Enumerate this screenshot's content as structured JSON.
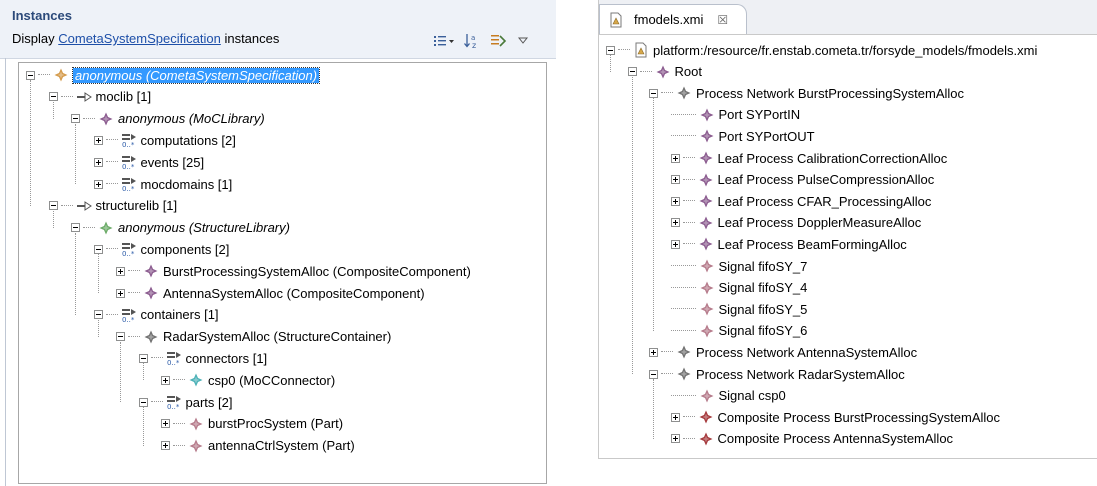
{
  "left_panel": {
    "title": "Instances",
    "display_prefix": "Display",
    "display_link": "CometaSystemSpecification",
    "display_suffix": "instances"
  },
  "left_tree": [
    {
      "label": "anonymous (CometaSystemSpecification)",
      "icon": "diamond-orange-icon",
      "style": "selected"
    },
    {
      "label": "moclib [1]",
      "icon": "arrow-link-icon"
    },
    {
      "label": "anonymous (MoCLibrary)",
      "icon": "diamond-purple-icon",
      "style": "italic"
    },
    {
      "label": "computations [2]",
      "icon": "collection-icon"
    },
    {
      "label": "events [25]",
      "icon": "collection-icon"
    },
    {
      "label": "mocdomains [1]",
      "icon": "collection-icon"
    },
    {
      "label": "structurelib [1]",
      "icon": "arrow-link-icon"
    },
    {
      "label": "anonymous (StructureLibrary)",
      "icon": "diamond-green-icon",
      "style": "italic"
    },
    {
      "label": "components [2]",
      "icon": "collection-icon"
    },
    {
      "label": "BurstProcessingSystemAlloc (CompositeComponent)",
      "icon": "diamond-purple-icon"
    },
    {
      "label": "AntennaSystemAlloc (CompositeComponent)",
      "icon": "diamond-purple-icon"
    },
    {
      "label": "containers [1]",
      "icon": "collection-icon"
    },
    {
      "label": "RadarSystemAlloc (StructureContainer)",
      "icon": "diamond-gray-icon"
    },
    {
      "label": "connectors [1]",
      "icon": "collection-icon"
    },
    {
      "label": "csp0 (MoCConnector)",
      "icon": "diamond-teal-icon"
    },
    {
      "label": "parts [2]",
      "icon": "collection-icon"
    },
    {
      "label": "burstProcSystem (Part)",
      "icon": "diamond-pink-icon"
    },
    {
      "label": "antennaCtrlSystem (Part)",
      "icon": "diamond-pink-icon"
    }
  ],
  "right_panel": {
    "tab_label": "fmodels.xmi",
    "tab_close": "☒"
  },
  "right_tree": [
    {
      "label": "platform:/resource/fr.enstab.cometa.tr/forsyde_models/fmodels.xmi",
      "icon": "resource-file-icon"
    },
    {
      "label": "Root",
      "icon": "diamond-purple-icon"
    },
    {
      "label": "Process Network BurstProcessingSystemAlloc",
      "icon": "diamond-gray-icon"
    },
    {
      "label": "Port SYPortIN",
      "icon": "diamond-purple-icon"
    },
    {
      "label": "Port SYPortOUT",
      "icon": "diamond-purple-icon"
    },
    {
      "label": "Leaf Process CalibrationCorrectionAlloc",
      "icon": "diamond-purple-icon"
    },
    {
      "label": "Leaf Process PulseCompressionAlloc",
      "icon": "diamond-purple-icon"
    },
    {
      "label": "Leaf Process CFAR_ProcessingAlloc",
      "icon": "diamond-purple-icon"
    },
    {
      "label": "Leaf Process DopplerMeasureAlloc",
      "icon": "diamond-purple-icon"
    },
    {
      "label": "Leaf Process BeamFormingAlloc",
      "icon": "diamond-purple-icon"
    },
    {
      "label": "Signal fifoSY_7",
      "icon": "diamond-pink-icon"
    },
    {
      "label": "Signal fifoSY_4",
      "icon": "diamond-pink-icon"
    },
    {
      "label": "Signal fifoSY_5",
      "icon": "diamond-pink-icon"
    },
    {
      "label": "Signal fifoSY_6",
      "icon": "diamond-pink-icon"
    },
    {
      "label": "Process Network AntennaSystemAlloc",
      "icon": "diamond-gray-icon"
    },
    {
      "label": "Process Network RadarSystemAlloc",
      "icon": "diamond-gray-icon"
    },
    {
      "label": "Signal csp0",
      "icon": "diamond-pink-icon"
    },
    {
      "label": "Composite Process BurstProcessingSystemAlloc",
      "icon": "diamond-red-icon"
    },
    {
      "label": "Composite Process AntennaSystemAlloc",
      "icon": "diamond-red-icon"
    }
  ],
  "colors": {
    "link": "#1d4fa8",
    "selection": "#3399ff",
    "title": "#2c4a7a",
    "diamond_purple": "#8a5a8e",
    "diamond_gray": "#707070",
    "diamond_pink": "#b57a8a",
    "diamond_red": "#a4373a",
    "diamond_green": "#6aaa66",
    "diamond_teal": "#4ab0b6",
    "diamond_orange": "#d49a4a"
  }
}
